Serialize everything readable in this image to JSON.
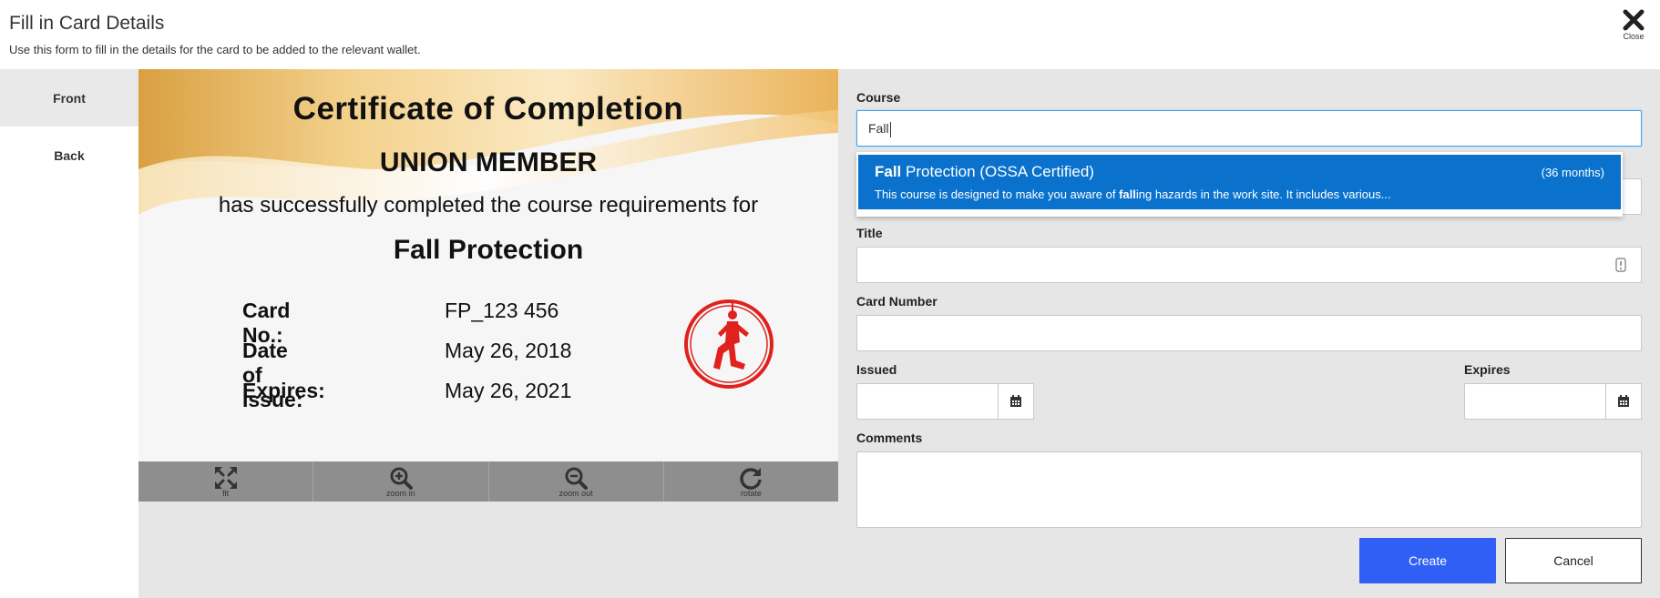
{
  "header": {
    "title": "Fill in Card Details",
    "subtitle": "Use this form to fill in the details for the card to be added to the relevant wallet.",
    "close_label": "Close"
  },
  "tabs": [
    {
      "label": "Front",
      "active": true
    },
    {
      "label": "Back",
      "active": false
    }
  ],
  "certificate": {
    "title": "Certificate of Completion",
    "member": "UNION MEMBER",
    "body": "has successfully completed the course requirements for",
    "course": "Fall Protection",
    "rows": [
      {
        "key": "Card No.:",
        "value": "FP_123 456"
      },
      {
        "key": "Date of Issue:",
        "value": "May 26, 2018"
      },
      {
        "key": "Expires:",
        "value": "May 26, 2021"
      }
    ]
  },
  "viewer_toolbar": {
    "fit": "fit",
    "zoom_in": "zoom in",
    "zoom_out": "zoom out",
    "rotate": "rotate"
  },
  "form": {
    "course_label": "Course",
    "course_value": "Fall",
    "title_label": "Title",
    "card_number_label": "Card Number",
    "issued_label": "Issued",
    "expires_label": "Expires",
    "comments_label": "Comments"
  },
  "suggestion": {
    "name_match": "Fall",
    "name_rest": " Protection (OSSA Certified)",
    "duration": "(36 months)",
    "desc_before": "This course is designed to make you aware of ",
    "desc_match": "fall",
    "desc_after": "ing hazards in the work site. It includes various..."
  },
  "buttons": {
    "create": "Create",
    "cancel": "Cancel"
  },
  "colors": {
    "primary": "#2f5ff5",
    "suggestion_bg": "#0a72cc",
    "focus_border": "#4aa3e8",
    "emblem_red": "#e0211d"
  }
}
